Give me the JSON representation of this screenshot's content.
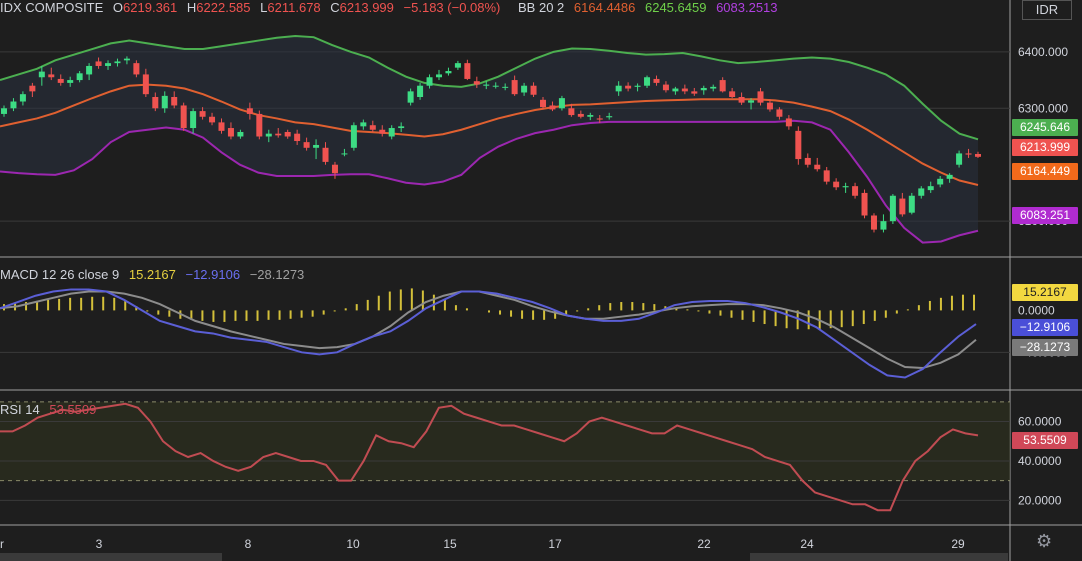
{
  "currency": "IDR",
  "price_legend": {
    "symbol": "IDX COMPOSITE",
    "o_label": "O",
    "o": "6219.361",
    "h_label": "H",
    "h": "6222.585",
    "l_label": "L",
    "l": "6211.678",
    "c_label": "C",
    "c": "6213.999",
    "change": "−5.183 (−0.08%)",
    "bb_label": "BB 20 2",
    "bb_mid": "6164.4486",
    "bb_upper": "6245.6459",
    "bb_lower": "6083.2513"
  },
  "macd_legend": {
    "label": "MACD 12 26 close 9",
    "hist": "15.2167",
    "macd": "−12.9106",
    "signal": "−28.1273"
  },
  "rsi_legend": {
    "label": "RSI 14",
    "value": "53.5509"
  },
  "price_labels": {
    "upper": "6245.646",
    "close": "6213.999",
    "mid": "6164.449",
    "lower": "6083.251"
  },
  "macd_labels": {
    "hist": "15.2167",
    "macd": "−12.9106",
    "signal": "−28.1273"
  },
  "rsi_label": "53.5509",
  "colors": {
    "up": "#26a69a",
    "up_bright": "#3ddc84",
    "down": "#ef5350",
    "bb_upper": "#4caf50",
    "bb_mid": "#e06030",
    "bb_lower": "#9c27b0",
    "macd": "#5b5fd6",
    "signal": "#8c8c8c",
    "hist": "#d4c03a",
    "rsi": "#c04c52"
  },
  "chart_data": [
    {
      "type": "candlestick",
      "name": "price",
      "yticks": [
        "6400.000",
        "6300.000",
        "6100.000"
      ],
      "ylim": [
        6040,
        6460
      ],
      "xtick_labels": [
        "r",
        "3",
        "8",
        "10",
        "15",
        "17",
        "22",
        "24",
        "29"
      ],
      "candles": [
        [
          6290,
          6305,
          6285,
          6300
        ],
        [
          6300,
          6318,
          6295,
          6312
        ],
        [
          6312,
          6330,
          6305,
          6325
        ],
        [
          6340,
          6345,
          6320,
          6330
        ],
        [
          6355,
          6375,
          6340,
          6365
        ],
        [
          6360,
          6372,
          6350,
          6355
        ],
        [
          6352,
          6360,
          6340,
          6345
        ],
        [
          6345,
          6356,
          6338,
          6350
        ],
        [
          6350,
          6366,
          6346,
          6362
        ],
        [
          6360,
          6380,
          6350,
          6375
        ],
        [
          6383,
          6390,
          6370,
          6375
        ],
        [
          6375,
          6385,
          6368,
          6380
        ],
        [
          6380,
          6388,
          6374,
          6383
        ],
        [
          6385,
          6392,
          6378,
          6388
        ],
        [
          6380,
          6385,
          6355,
          6360
        ],
        [
          6360,
          6370,
          6320,
          6325
        ],
        [
          6320,
          6328,
          6295,
          6300
        ],
        [
          6300,
          6330,
          6292,
          6322
        ],
        [
          6320,
          6330,
          6300,
          6305
        ],
        [
          6305,
          6310,
          6260,
          6265
        ],
        [
          6265,
          6300,
          6255,
          6295
        ],
        [
          6295,
          6302,
          6280,
          6285
        ],
        [
          6285,
          6292,
          6270,
          6275
        ],
        [
          6275,
          6282,
          6255,
          6260
        ],
        [
          6265,
          6275,
          6245,
          6250
        ],
        [
          6250,
          6262,
          6246,
          6258
        ],
        [
          6300,
          6310,
          6280,
          6290
        ],
        [
          6290,
          6296,
          6245,
          6250
        ],
        [
          6250,
          6262,
          6240,
          6255
        ],
        [
          6255,
          6265,
          6248,
          6252
        ],
        [
          6258,
          6262,
          6246,
          6250
        ],
        [
          6255,
          6262,
          6235,
          6242
        ],
        [
          6240,
          6248,
          6225,
          6230
        ],
        [
          6230,
          6245,
          6210,
          6235
        ],
        [
          6230,
          6240,
          6200,
          6205
        ],
        [
          6200,
          6205,
          6175,
          6185
        ],
        [
          6220,
          6228,
          6215,
          6220
        ],
        [
          6230,
          6275,
          6225,
          6270
        ],
        [
          6268,
          6280,
          6262,
          6275
        ],
        [
          6270,
          6278,
          6258,
          6262
        ],
        [
          6262,
          6270,
          6250,
          6255
        ],
        [
          6250,
          6270,
          6245,
          6265
        ],
        [
          6265,
          6275,
          6258,
          6268
        ],
        [
          6310,
          6335,
          6305,
          6330
        ],
        [
          6320,
          6345,
          6315,
          6340
        ],
        [
          6340,
          6360,
          6335,
          6355
        ],
        [
          6355,
          6368,
          6350,
          6360
        ],
        [
          6362,
          6372,
          6358,
          6366
        ],
        [
          6372,
          6384,
          6368,
          6380
        ],
        [
          6380,
          6386,
          6350,
          6352
        ],
        [
          6348,
          6356,
          6336,
          6342
        ],
        [
          6340,
          6348,
          6334,
          6342
        ],
        [
          6340,
          6346,
          6335,
          6340
        ],
        [
          6338,
          6344,
          6332,
          6338
        ],
        [
          6350,
          6358,
          6322,
          6325
        ],
        [
          6328,
          6345,
          6322,
          6340
        ],
        [
          6340,
          6346,
          6320,
          6324
        ],
        [
          6315,
          6320,
          6298,
          6302
        ],
        [
          6305,
          6312,
          6295,
          6298
        ],
        [
          6300,
          6322,
          6296,
          6318
        ],
        [
          6300,
          6308,
          6285,
          6288
        ],
        [
          6290,
          6296,
          6282,
          6285
        ],
        [
          6285,
          6292,
          6279,
          6288
        ],
        [
          6282,
          6288,
          6274,
          6280
        ],
        [
          6284,
          6292,
          6280,
          6286
        ],
        [
          6330,
          6348,
          6322,
          6340
        ],
        [
          6340,
          6346,
          6330,
          6335
        ],
        [
          6338,
          6344,
          6330,
          6340
        ],
        [
          6340,
          6358,
          6336,
          6355
        ],
        [
          6352,
          6358,
          6340,
          6345
        ],
        [
          6342,
          6348,
          6328,
          6332
        ],
        [
          6330,
          6338,
          6324,
          6335
        ],
        [
          6335,
          6342,
          6325,
          6330
        ],
        [
          6330,
          6336,
          6322,
          6326
        ],
        [
          6332,
          6340,
          6324,
          6336
        ],
        [
          6335,
          6342,
          6330,
          6338
        ],
        [
          6350,
          6355,
          6328,
          6330
        ],
        [
          6330,
          6336,
          6318,
          6320
        ],
        [
          6320,
          6328,
          6306,
          6310
        ],
        [
          6310,
          6318,
          6298,
          6314
        ],
        [
          6330,
          6336,
          6305,
          6310
        ],
        [
          6310,
          6316,
          6294,
          6298
        ],
        [
          6298,
          6302,
          6280,
          6285
        ],
        [
          6282,
          6288,
          6262,
          6268
        ],
        [
          6260,
          6268,
          6200,
          6210
        ],
        [
          6212,
          6220,
          6195,
          6200
        ],
        [
          6200,
          6212,
          6188,
          6192
        ],
        [
          6190,
          6196,
          6165,
          6170
        ],
        [
          6170,
          6176,
          6155,
          6160
        ],
        [
          6160,
          6168,
          6150,
          6162
        ],
        [
          6162,
          6168,
          6140,
          6145
        ],
        [
          6150,
          6156,
          6105,
          6110
        ],
        [
          6110,
          6114,
          6080,
          6085
        ],
        [
          6085,
          6112,
          6080,
          6100
        ],
        [
          6100,
          6148,
          6095,
          6145
        ],
        [
          6140,
          6150,
          6108,
          6112
        ],
        [
          6115,
          6150,
          6112,
          6145
        ],
        [
          6145,
          6162,
          6140,
          6158
        ],
        [
          6155,
          6170,
          6150,
          6162
        ],
        [
          6165,
          6180,
          6160,
          6175
        ],
        [
          6175,
          6185,
          6168,
          6182
        ],
        [
          6200,
          6225,
          6195,
          6220
        ],
        [
          6220,
          6228,
          6212,
          6218
        ],
        [
          6219,
          6223,
          6212,
          6214
        ]
      ],
      "bb_upper": [
        6350,
        6360,
        6370,
        6385,
        6395,
        6405,
        6415,
        6420,
        6415,
        6410,
        6405,
        6405,
        6410,
        6415,
        6420,
        6425,
        6428,
        6426,
        6412,
        6400,
        6390,
        6372,
        6356,
        6345,
        6340,
        6338,
        6344,
        6356,
        6372,
        6388,
        6400,
        6406,
        6405,
        6402,
        6398,
        6395,
        6396,
        6398,
        6392,
        6385,
        6380,
        6382,
        6385,
        6388,
        6390,
        6388,
        6382,
        6372,
        6360,
        6340,
        6308,
        6278,
        6255,
        6245
      ],
      "bb_mid": [
        6268,
        6275,
        6282,
        6292,
        6305,
        6318,
        6330,
        6340,
        6342,
        6340,
        6335,
        6325,
        6312,
        6298,
        6288,
        6282,
        6275,
        6272,
        6266,
        6260,
        6258,
        6256,
        6253,
        6250,
        6254,
        6262,
        6272,
        6282,
        6290,
        6297,
        6302,
        6306,
        6307,
        6309,
        6311,
        6313,
        6314,
        6315,
        6316,
        6316,
        6316,
        6316,
        6314,
        6310,
        6303,
        6295,
        6280,
        6262,
        6242,
        6222,
        6202,
        6186,
        6172,
        6164
      ],
      "bb_lower": [
        6188,
        6185,
        6183,
        6182,
        6190,
        6210,
        6240,
        6258,
        6262,
        6266,
        6262,
        6248,
        6222,
        6200,
        6186,
        6180,
        6180,
        6180,
        6182,
        6183,
        6183,
        6176,
        6168,
        6165,
        6170,
        6182,
        6212,
        6232,
        6246,
        6256,
        6262,
        6270,
        6274,
        6276,
        6276,
        6276,
        6276,
        6276,
        6276,
        6276,
        6276,
        6276,
        6276,
        6278,
        6275,
        6262,
        6222,
        6178,
        6128,
        6088,
        6062,
        6064,
        6075,
        6083
      ],
      "close_label": "6213.999"
    },
    {
      "type": "line+bar",
      "name": "macd",
      "yticks": [
        "0.0000",
        "−40.0000"
      ],
      "ylim": [
        -75,
        50
      ],
      "hist": [
        6,
        7,
        8,
        9,
        10,
        11,
        12,
        12,
        13,
        13,
        12,
        9,
        4,
        -1,
        -4,
        -6,
        -8,
        -9,
        -10,
        -11,
        -11,
        -10,
        -10,
        -10,
        -9,
        -9,
        -8,
        -7,
        -6,
        -4,
        -1,
        2,
        6,
        10,
        14,
        18,
        20,
        21,
        19,
        15,
        10,
        5,
        2,
        0,
        -2,
        -4,
        -6,
        -8,
        -9,
        -9,
        -8,
        -5,
        -1,
        2,
        5,
        7,
        8,
        8,
        7,
        6,
        4,
        2,
        1,
        -1,
        -3,
        -5,
        -7,
        -9,
        -11,
        -13,
        -15,
        -17,
        -18,
        -18,
        -18,
        -17,
        -16,
        -15,
        -13,
        -10,
        -7,
        -3,
        1,
        5,
        9,
        12,
        14,
        15,
        15
      ],
      "macd": [
        2,
        8,
        14,
        18,
        20,
        20,
        18,
        10,
        0,
        -10,
        -15,
        -20,
        -22,
        -26,
        -28,
        -30,
        -35,
        -40,
        -42,
        -40,
        -32,
        -25,
        -20,
        -10,
        2,
        10,
        18,
        18,
        16,
        12,
        8,
        2,
        -5,
        -8,
        -10,
        -10,
        -8,
        -2,
        5,
        8,
        9,
        9,
        7,
        3,
        -2,
        -8,
        -16,
        -28,
        -40,
        -52,
        -62,
        -64,
        -56,
        -40,
        -25,
        -13
      ],
      "signal": [
        2,
        4,
        8,
        12,
        16,
        18,
        18,
        16,
        12,
        6,
        -2,
        -10,
        -15,
        -20,
        -24,
        -28,
        -32,
        -34,
        -36,
        -35,
        -32,
        -25,
        -15,
        -2,
        8,
        14,
        18,
        18,
        14,
        10,
        4,
        -1,
        -5,
        -8,
        -8,
        -6,
        -4,
        -1,
        2,
        4,
        5,
        6,
        6,
        5,
        2,
        -2,
        -8,
        -16,
        -26,
        -36,
        -46,
        -54,
        -55,
        -50,
        -42,
        -28
      ]
    },
    {
      "type": "line",
      "name": "rsi",
      "yticks": [
        "60.0000",
        "40.0000",
        "20.0000"
      ],
      "ylim": [
        8,
        75
      ],
      "band": [
        30,
        70
      ],
      "values": [
        55,
        55,
        58,
        62,
        64,
        66,
        65,
        66,
        67,
        68,
        69,
        67,
        60,
        50,
        45,
        42,
        44,
        40,
        37,
        35,
        37,
        42,
        44,
        42,
        40,
        40,
        38,
        30,
        30,
        40,
        53,
        50,
        49,
        47,
        55,
        67,
        68,
        64,
        62,
        60,
        58,
        58,
        56,
        54,
        52,
        50,
        54,
        60,
        62,
        60,
        58,
        56,
        54,
        54,
        58,
        56,
        54,
        52,
        50,
        48,
        46,
        42,
        40,
        38,
        30,
        24,
        22,
        20,
        18,
        18,
        15,
        15,
        30,
        40,
        45,
        52,
        56,
        54,
        53
      ],
      "last": "53.5509"
    }
  ]
}
